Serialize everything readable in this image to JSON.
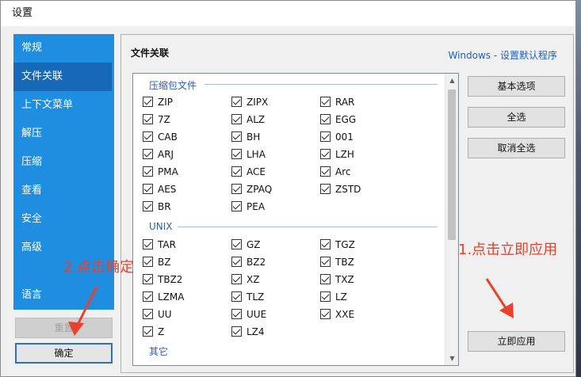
{
  "window": {
    "title": "设置"
  },
  "sidebar": {
    "items": [
      {
        "label": "常规"
      },
      {
        "label": "文件关联"
      },
      {
        "label": "上下文菜单"
      },
      {
        "label": "解压"
      },
      {
        "label": "压缩"
      },
      {
        "label": "查看"
      },
      {
        "label": "安全"
      },
      {
        "label": "高级"
      },
      {
        "label": "语言"
      }
    ],
    "active_index": 1,
    "reset_label": "重置",
    "ok_label": "确定"
  },
  "panel": {
    "title": "文件关联",
    "link": "Windows - 设置默认程序",
    "groups": [
      {
        "label": "压缩包文件",
        "items": [
          "ZIP",
          "ZIPX",
          "RAR",
          "7Z",
          "ALZ",
          "EGG",
          "CAB",
          "BH",
          "001",
          "ARJ",
          "LHA",
          "LZH",
          "PMA",
          "ACE",
          "Arc",
          "AES",
          "ZPAQ",
          "ZSTD",
          "BR",
          "PEA"
        ]
      },
      {
        "label": "UNIX",
        "items": [
          "TAR",
          "GZ",
          "TGZ",
          "BZ",
          "BZ2",
          "TBZ",
          "TBZ2",
          "XZ",
          "TXZ",
          "LZMA",
          "TLZ",
          "LZ",
          "UU",
          "UUE",
          "XXE",
          "Z",
          "LZ4"
        ]
      },
      {
        "label": "其它",
        "items": []
      }
    ],
    "buttons": {
      "basic": "基本选项",
      "select_all": "全选",
      "deselect_all": "取消全选",
      "apply": "立即应用"
    }
  },
  "annotations": {
    "step1": "1.点击立即应用",
    "step2": "2.点击确定",
    "color": "#e8412c"
  }
}
